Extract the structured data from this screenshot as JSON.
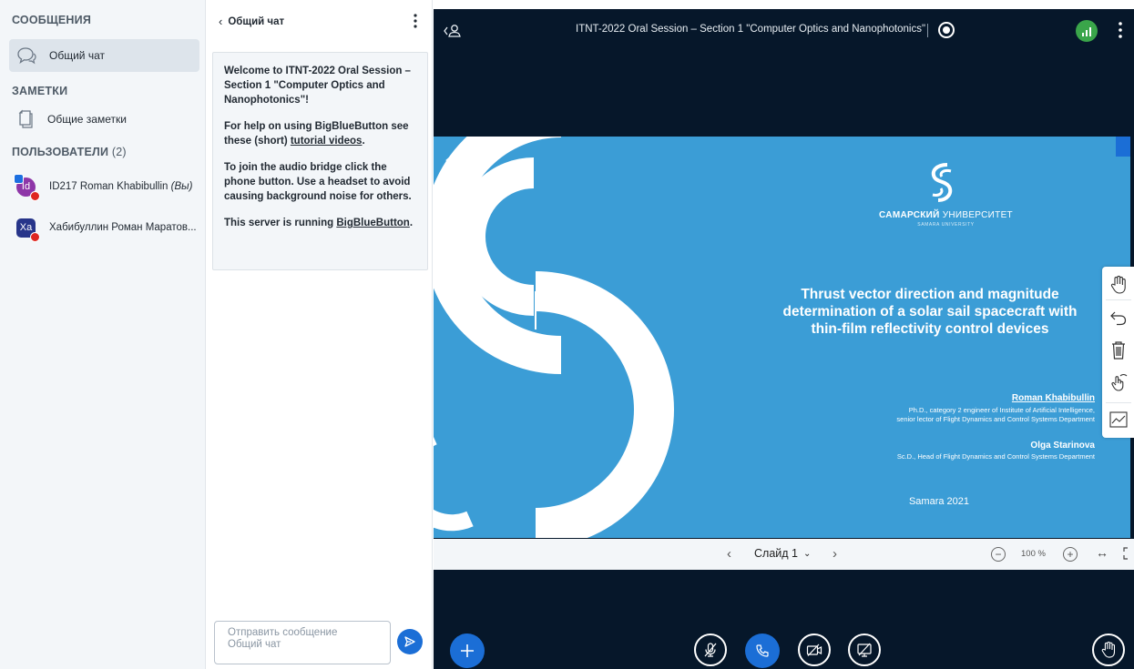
{
  "sidebar": {
    "messages_title": "СООБЩЕНИЯ",
    "public_chat": "Общий чат",
    "notes_title": "ЗАМЕТКИ",
    "shared_notes": "Общие заметки",
    "users_title": "ПОЛЬЗОВАТЕЛИ",
    "users_count": "(2)",
    "users": [
      {
        "initials": "Id",
        "name": "ID217 Roman Khabibullin",
        "suffix": "(Вы)"
      },
      {
        "initials": "Ха",
        "name": "Хабибуллин Роман Маратов..."
      }
    ]
  },
  "chat": {
    "title": "Общий чат",
    "welcome": {
      "line1_prefix": "Welcome to ",
      "line1_bold": "ITNT-2022 Oral Session – Section 1 \"Computer Optics and Nanophotonics\"",
      "line1_suffix": "!",
      "line2_prefix": "For help on using BigBlueButton see these (short) ",
      "line2_link": "tutorial videos",
      "line2_suffix": ".",
      "line3": "To join the audio bridge click the phone button. Use a headset to avoid causing background noise for others.",
      "line4_prefix": "This server is running ",
      "line4_link": "BigBlueButton",
      "line4_suffix": "."
    },
    "input_placeholder_1": "Отправить сообщение",
    "input_placeholder_2": "Общий чат"
  },
  "topbar": {
    "meeting_title": "ITNT-2022 Oral Session – Section 1 \"Computer Optics and Nanophotonics\""
  },
  "slide": {
    "university_bold": "САМАРСКИЙ",
    "university_rest": " УНИВЕРСИТЕТ",
    "university_en": "SAMARA UNIVERSITY",
    "title": "Thrust vector direction and magnitude determination of a solar sail spacecraft with thin-film reflectivity control devices",
    "author1": "Roman Khabibullin",
    "author1_desc_1": "Ph.D., category 2 engineer of Institute of Artificial Intelligence,",
    "author1_desc_2": "senior lector of Flight Dynamics and Control Systems Department",
    "author2": "Olga Starinova",
    "author2_desc": "Sc.D., Head of Flight Dynamics and Control Systems Department",
    "date": "Samara 2021"
  },
  "slide_nav": {
    "current_slide": "Слайд 1",
    "zoom": "100 %"
  },
  "colors": {
    "accent": "#1b6ed6",
    "stage_bg": "#06172a",
    "slide_bg": "#3b9dd6"
  },
  "icons": {
    "chat": "chat-bubble-icon",
    "notes": "notes-icon",
    "send": "send-icon",
    "record": "record-icon",
    "connection": "connection-status-icon"
  }
}
